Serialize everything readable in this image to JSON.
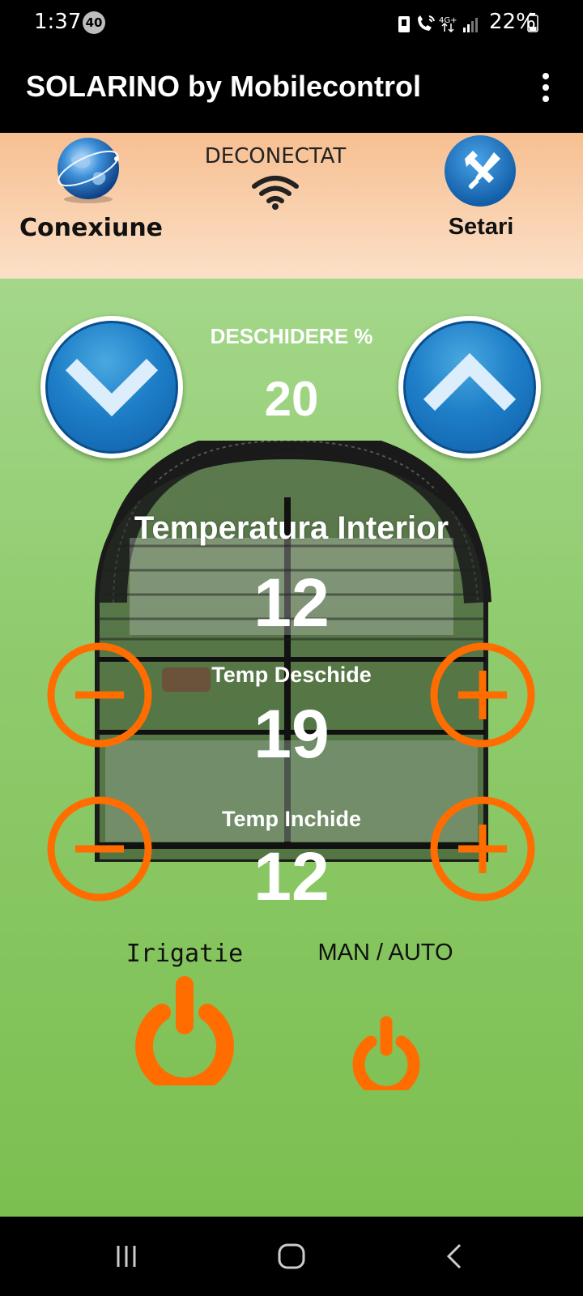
{
  "status_bar": {
    "time": "1:37",
    "notification_count": "40",
    "network": "4G+",
    "battery": "22%"
  },
  "app_bar": {
    "title": "SOLARINO by Mobilecontrol",
    "menu_icon": "more-vert-icon"
  },
  "connection_panel": {
    "connection_label": "Conexiune",
    "status": "DECONECTAT",
    "settings_label": "Setari"
  },
  "controls": {
    "opening_label": "DESCHIDERE %",
    "opening_value": "20",
    "inside_temp_label": "Temperatura Interior",
    "inside_temp_value": "12",
    "open_temp_label": "Temp Deschide",
    "open_temp_value": "19",
    "close_temp_label": "Temp Inchide",
    "close_temp_value": "12",
    "irrigation_label": "Irigatie",
    "mode_label": "MAN / AUTO"
  },
  "colors": {
    "accent_orange": "#ff6d00",
    "button_blue": "#1e7fc8",
    "panel_peach": "#f7bf91",
    "background_green": "#8fcb6d"
  }
}
